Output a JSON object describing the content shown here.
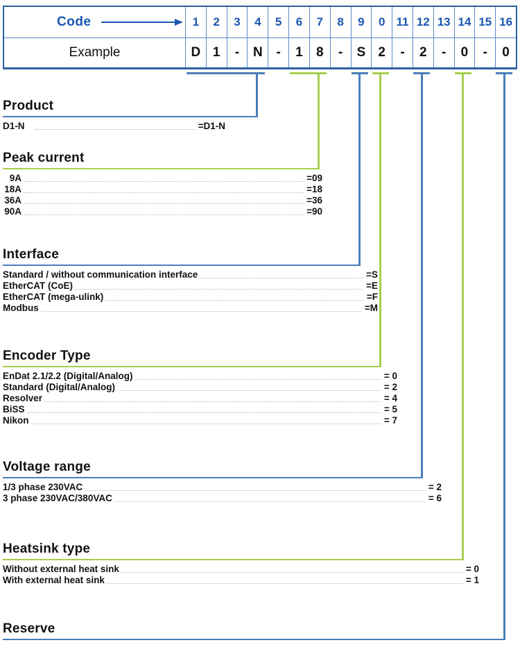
{
  "table": {
    "code_label": "Code",
    "example_label": "Example",
    "columns": [
      "1",
      "2",
      "3",
      "4",
      "5",
      "6",
      "7",
      "8",
      "9",
      "0",
      "11",
      "12",
      "13",
      "14",
      "15",
      "16"
    ],
    "example_values": [
      "D",
      "1",
      "-",
      "N",
      "-",
      "1",
      "8",
      "-",
      "S",
      "2",
      "-",
      "2",
      "-",
      "0",
      "-",
      "0"
    ]
  },
  "colors": {
    "blue": "#4a7ebb",
    "blue_dark": "#2e5fa3",
    "blue_text": "#1a56b0",
    "green": "#a8ce4f",
    "leader": "#b8b8b8"
  },
  "sections": [
    {
      "title": "Product",
      "rule_color": "blue",
      "options": [
        {
          "name": "D1-N",
          "value": "=D1-N"
        }
      ]
    },
    {
      "title": "Peak current",
      "rule_color": "green",
      "options": [
        {
          "name": "9A",
          "value": "=09"
        },
        {
          "name": "18A",
          "value": "=18"
        },
        {
          "name": "36A",
          "value": "=36"
        },
        {
          "name": "90A",
          "value": "=90"
        }
      ]
    },
    {
      "title": "Interface",
      "rule_color": "blue",
      "options": [
        {
          "name": "Standard / without communication interface",
          "value": "=S"
        },
        {
          "name": "EtherCAT (CoE)",
          "value": "=E"
        },
        {
          "name": "EtherCAT (mega-ulink)",
          "value": "=F"
        },
        {
          "name": "Modbus",
          "value": "=M"
        }
      ]
    },
    {
      "title": "Encoder Type",
      "rule_color": "green",
      "options": [
        {
          "name": "EnDat 2.1/2.2 (Digital/Analog)",
          "value": "= 0"
        },
        {
          "name": "Standard (Digital/Analog)",
          "value": "= 2"
        },
        {
          "name": "Resolver",
          "value": "= 4"
        },
        {
          "name": "BiSS",
          "value": "= 5"
        },
        {
          "name": "Nikon",
          "value": "= 7"
        }
      ]
    },
    {
      "title": "Voltage range",
      "rule_color": "blue",
      "options": [
        {
          "name": "1/3 phase 230VAC",
          "value": "= 2"
        },
        {
          "name": "3 phase 230VAC/380VAC",
          "value": "= 6"
        }
      ]
    },
    {
      "title": "Heatsink type",
      "rule_color": "green",
      "options": [
        {
          "name": "Without external heat sink",
          "value": "= 0"
        },
        {
          "name": "With external heat sink",
          "value": "= 1"
        }
      ]
    },
    {
      "title": "Reserve",
      "rule_color": "blue",
      "options": []
    }
  ]
}
